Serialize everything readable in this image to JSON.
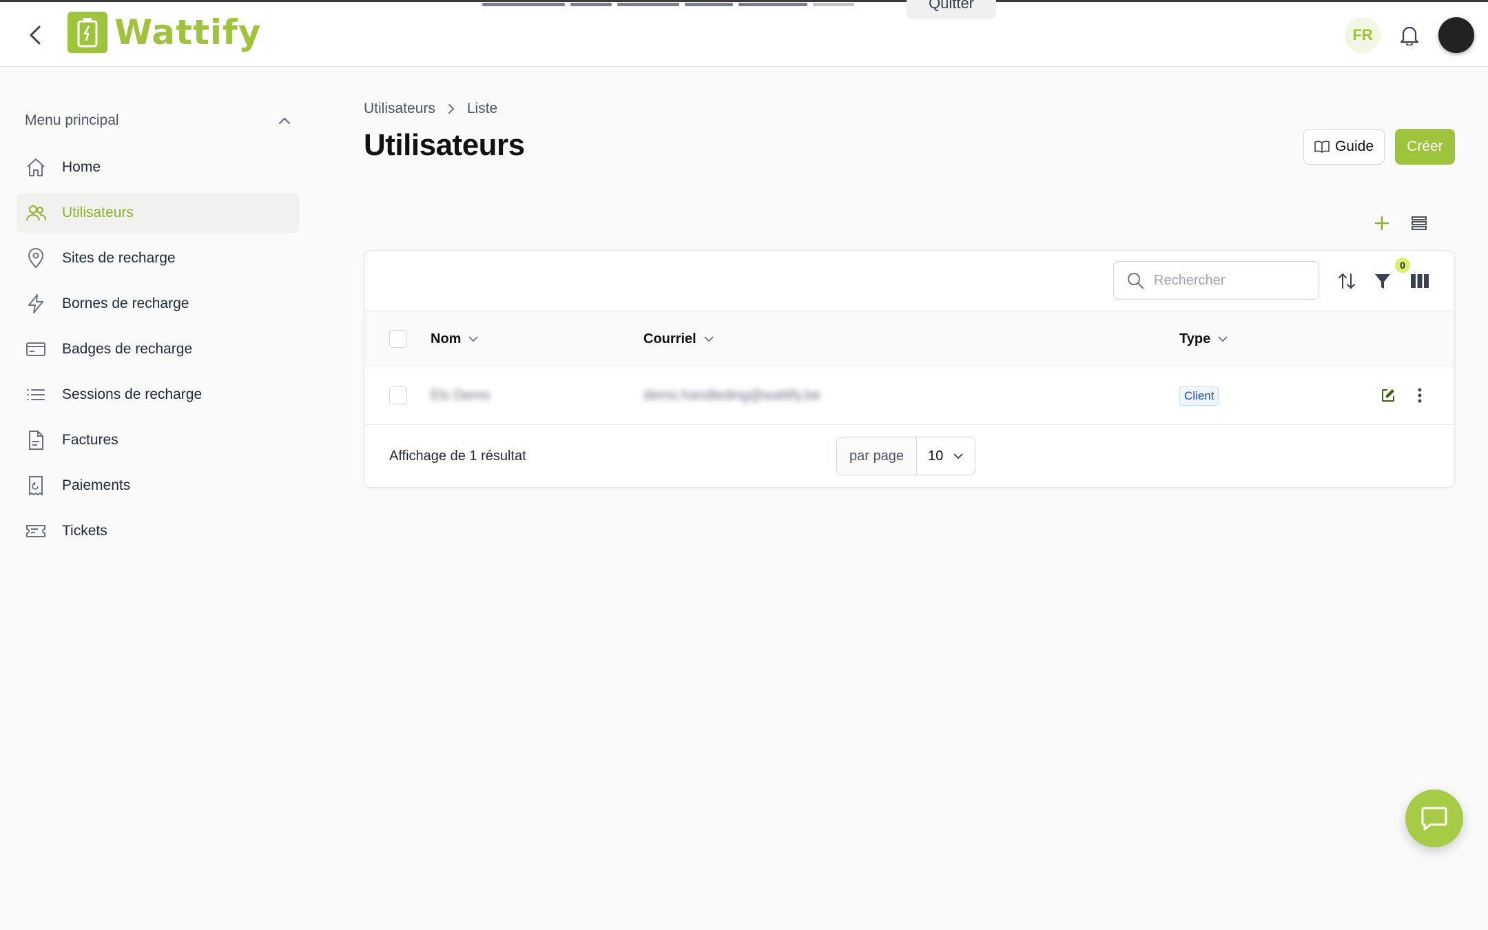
{
  "banner": {
    "quit_label": "Quitter"
  },
  "header": {
    "brand": "Wattify",
    "lang": "FR"
  },
  "sidebar": {
    "section_title": "Menu principal",
    "items": [
      {
        "label": "Home",
        "icon": "home-icon"
      },
      {
        "label": "Utilisateurs",
        "icon": "users-icon",
        "active": true
      },
      {
        "label": "Sites de recharge",
        "icon": "map-pin-icon"
      },
      {
        "label": "Bornes de recharge",
        "icon": "lightning-icon"
      },
      {
        "label": "Badges de recharge",
        "icon": "card-icon"
      },
      {
        "label": "Sessions de recharge",
        "icon": "list-icon"
      },
      {
        "label": "Factures",
        "icon": "document-icon"
      },
      {
        "label": "Paiements",
        "icon": "receipt-icon"
      },
      {
        "label": "Tickets",
        "icon": "ticket-icon"
      }
    ]
  },
  "breadcrumb": {
    "root": "Utilisateurs",
    "current": "Liste"
  },
  "page": {
    "title": "Utilisateurs"
  },
  "actions": {
    "guide_label": "Guide",
    "create_label": "Créer"
  },
  "table": {
    "search_placeholder": "Rechercher",
    "filter_count": "0",
    "columns": [
      {
        "label": "Nom"
      },
      {
        "label": "Courriel"
      },
      {
        "label": "Type"
      }
    ],
    "rows": [
      {
        "name": "Els Demo",
        "email": "demo.handleding@wattify.be",
        "type": "Client"
      }
    ],
    "result_text": "Affichage de 1 résultat",
    "per_page_label": "par page",
    "per_page_value": "10"
  },
  "colors": {
    "accent": "#9dc43a",
    "active_bg": "#f1f2ef"
  }
}
